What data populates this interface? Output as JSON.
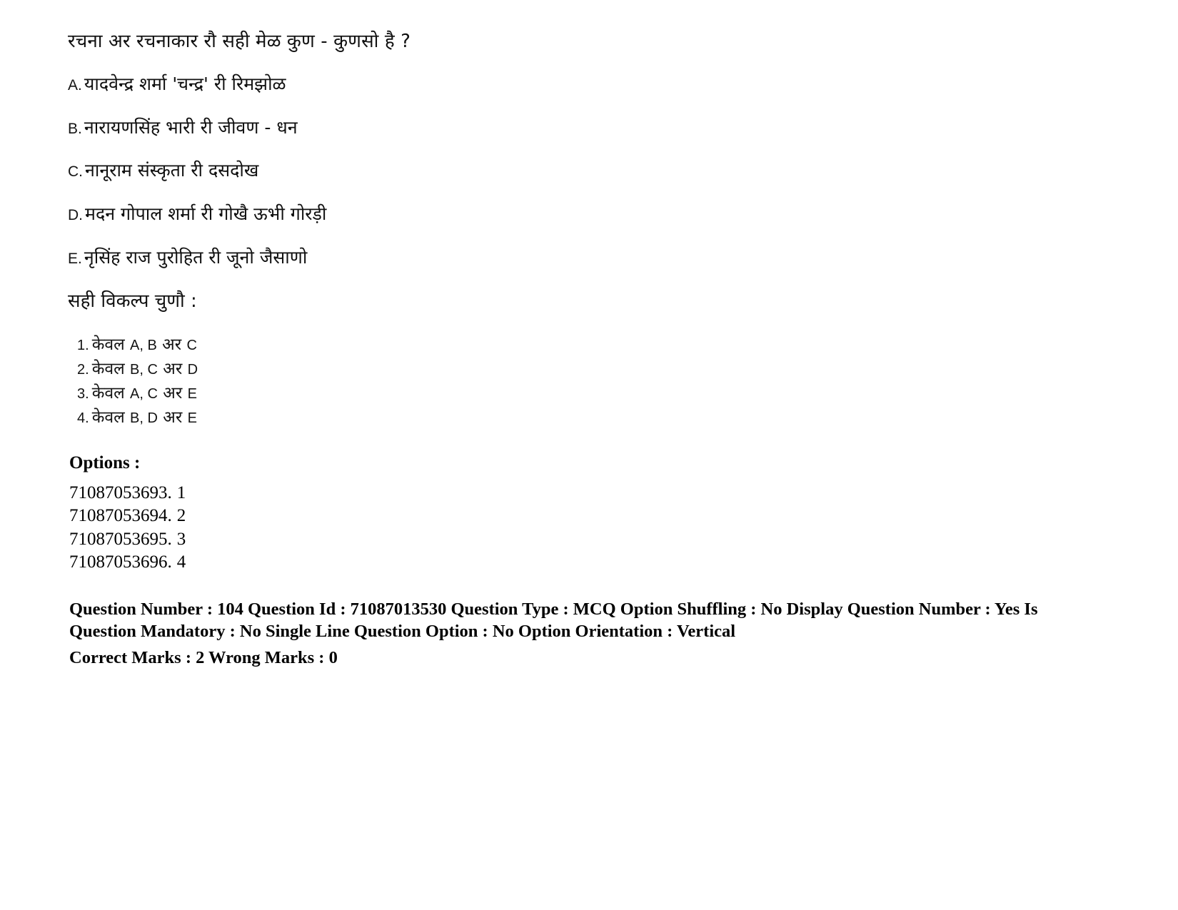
{
  "question": {
    "stem": "रचना अर रचनाकार रौ सही मेळ कुण - कुणसो है ?",
    "statements": [
      {
        "label": "A.",
        "text": "यादवेन्द्र शर्मा 'चन्द्र' री रिमझोळ"
      },
      {
        "label": "B.",
        "text": "नारायणसिंह भारी री जीवण - धन"
      },
      {
        "label": "C.",
        "text": "नानूराम संस्कृता री दसदोख"
      },
      {
        "label": "D.",
        "text": "मदन गोपाल शर्मा री गोखै ऊभी गोरड़ी"
      },
      {
        "label": "E.",
        "text": "नृसिंह राज पुरोहित री जूनो जैसाणो"
      }
    ],
    "choose_prompt": "सही विकल्प चुणौ :",
    "alternatives": [
      {
        "num": "1.",
        "prefix": "केवल",
        "latin": "A, B",
        "conj": "अर",
        "last": "C"
      },
      {
        "num": "2.",
        "prefix": "केवल",
        "latin": "B, C",
        "conj": "अर",
        "last": "D"
      },
      {
        "num": "3.",
        "prefix": "केवल",
        "latin": "A, C",
        "conj": "अर",
        "last": "E"
      },
      {
        "num": "4.",
        "prefix": "केवल",
        "latin": "B, D",
        "conj": "अर",
        "last": "E"
      }
    ]
  },
  "options": {
    "title": "Options :",
    "items": [
      {
        "id": "71087053693.",
        "value": "1"
      },
      {
        "id": "71087053694.",
        "value": "2"
      },
      {
        "id": "71087053695.",
        "value": "3"
      },
      {
        "id": "71087053696.",
        "value": "4"
      }
    ]
  },
  "metadata": {
    "line1": "Question Number : 104 Question Id : 71087013530 Question Type : MCQ Option Shuffling : No Display Question Number : Yes Is",
    "line2": "Question Mandatory : No Single Line Question Option : No Option Orientation : Vertical",
    "line3": "Correct Marks : 2 Wrong Marks : 0"
  }
}
